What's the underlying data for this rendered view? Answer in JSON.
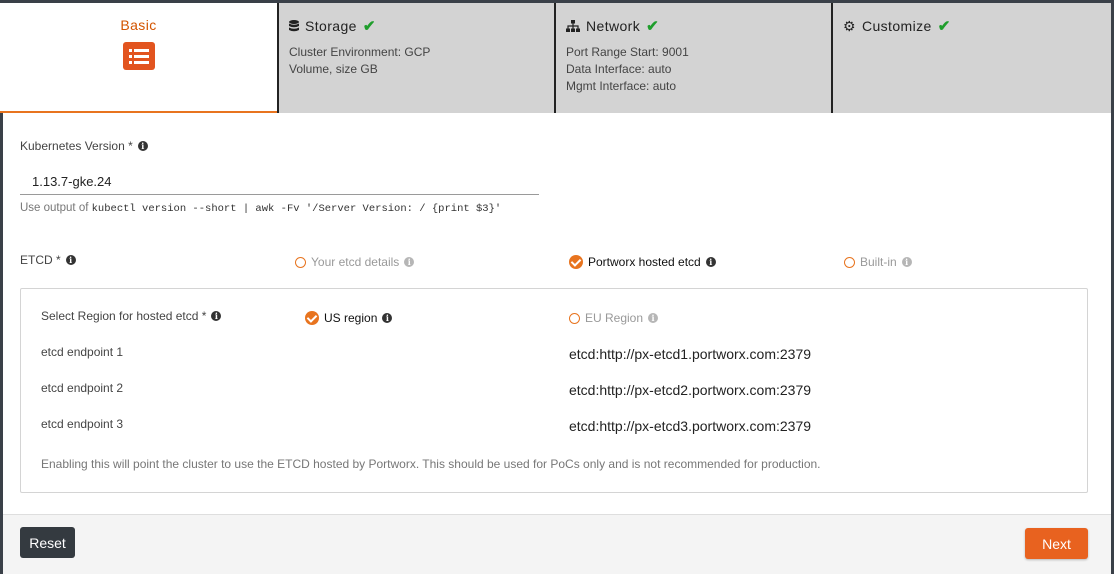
{
  "steps": {
    "basic": {
      "label": "Basic"
    },
    "storage": {
      "label": "Storage",
      "lines": [
        "Cluster Environment: GCP",
        "Volume, size GB"
      ]
    },
    "network": {
      "label": "Network",
      "lines": [
        "Port Range Start: 9001",
        "Data Interface: auto",
        "Mgmt Interface: auto"
      ]
    },
    "customize": {
      "label": "Customize"
    }
  },
  "kubernetes": {
    "label": "Kubernetes Version *",
    "value": "1.13.7-gke.24",
    "hint_prefix": "Use output of",
    "hint_code": "kubectl version --short | awk -Fv '/Server Version: / {print $3}'"
  },
  "etcd": {
    "label": "ETCD *",
    "options": [
      {
        "label": "Your etcd details",
        "checked": false
      },
      {
        "label": "Portworx hosted etcd",
        "checked": true
      },
      {
        "label": "Built-in",
        "checked": false
      }
    ]
  },
  "hosted": {
    "region_label": "Select Region for hosted etcd *",
    "regions": [
      {
        "label": "US region",
        "checked": true
      },
      {
        "label": "EU Region",
        "checked": false
      }
    ],
    "endpoints": [
      {
        "label": "etcd endpoint 1",
        "value": "etcd:http://px-etcd1.portworx.com:2379"
      },
      {
        "label": "etcd endpoint 2",
        "value": "etcd:http://px-etcd2.portworx.com:2379"
      },
      {
        "label": "etcd endpoint 3",
        "value": "etcd:http://px-etcd3.portworx.com:2379"
      }
    ],
    "note": "Enabling this will point the cluster to use the ETCD hosted by Portworx. This should be used for PoCs only and is not recommended for production."
  },
  "footer": {
    "reset_label": "Reset",
    "next_label": "Next"
  },
  "colors": {
    "accent": "#e8741f",
    "check": "#1f9e2c",
    "dark_button": "#343a40"
  }
}
